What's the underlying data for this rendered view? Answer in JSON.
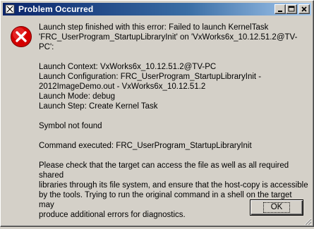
{
  "window": {
    "title": "Problem Occurred"
  },
  "icons": {
    "app": "app-icon",
    "error": "error-icon",
    "minimize": "minimize-icon",
    "maximize": "maximize-icon",
    "close": "close-icon"
  },
  "colors": {
    "titlebar_start": "#0a246a",
    "titlebar_end": "#a6caf0",
    "error_red": "#d40000",
    "face": "#d4d0c8"
  },
  "message": {
    "line1": "Launch step finished with this error: Failed to launch KernelTask",
    "line2": "'FRC_UserProgram_StartupLibraryInit' on 'VxWorks6x_10.12.51.2@TV-PC':",
    "context": "Launch Context: VxWorks6x_10.12.51.2@TV-PC",
    "configuration1": "Launch Configuration: FRC_UserProgram_StartupLibraryInit -",
    "configuration2": "2012ImageDemo.out - VxWorks6x_10.12.51.2",
    "mode": "Launch Mode: debug",
    "step": "Launch Step: Create Kernel Task",
    "symbol": "Symbol not found",
    "command": "Command executed: FRC_UserProgram_StartupLibraryInit",
    "help1": "Please check that the target can access the file as well as all required shared",
    "help2": "libraries through its file system, and ensure that the host-copy is accessible",
    "help3": "by the tools. Trying to run the original command in a shell on the target may",
    "help4": "produce additional errors for diagnostics."
  },
  "buttons": {
    "ok": "OK"
  }
}
